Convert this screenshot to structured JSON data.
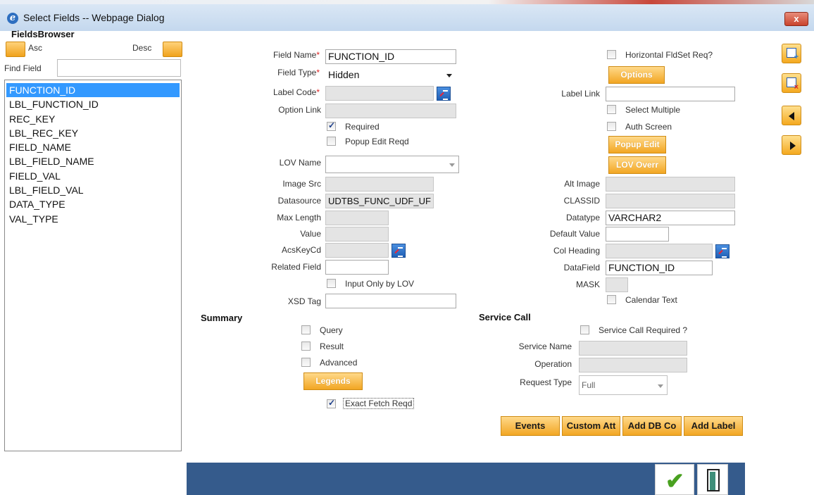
{
  "window": {
    "title": "Select Fields -- Webpage Dialog",
    "close_label": "x"
  },
  "fields_browser": {
    "title": "FieldsBrowser",
    "asc_label": "Asc",
    "desc_label": "Desc",
    "find_label": "Find Field",
    "find_value": "",
    "items": [
      "FUNCTION_ID",
      "LBL_FUNCTION_ID",
      "REC_KEY",
      "LBL_REC_KEY",
      "FIELD_NAME",
      "LBL_FIELD_NAME",
      "FIELD_VAL",
      "LBL_FIELD_VAL",
      "DATA_TYPE",
      "VAL_TYPE"
    ],
    "selected_index": 0
  },
  "form": {
    "field_name": {
      "label": "Field Name",
      "value": "FUNCTION_ID"
    },
    "field_type": {
      "label": "Field Type",
      "value": "Hidden"
    },
    "label_code": {
      "label": "Label Code",
      "value": ""
    },
    "option_link": {
      "label": "Option Link",
      "value": ""
    },
    "required": {
      "label": "Required",
      "checked": true
    },
    "popup_edit_reqd": {
      "label": "Popup Edit Reqd",
      "checked": false
    },
    "lov_name": {
      "label": "LOV Name",
      "value": ""
    },
    "image_src": {
      "label": "Image Src",
      "value": ""
    },
    "datasource": {
      "label": "Datasource",
      "value": "UDTBS_FUNC_UDF_UF"
    },
    "max_length": {
      "label": "Max Length",
      "value": ""
    },
    "value": {
      "label": "Value",
      "value": ""
    },
    "acs_key_cd": {
      "label": "AcsKeyCd",
      "value": ""
    },
    "related_field": {
      "label": "Related Field",
      "value": ""
    },
    "input_only_by_lov": {
      "label": "Input Only by LOV",
      "checked": false
    },
    "xsd_tag": {
      "label": "XSD Tag",
      "value": ""
    },
    "horizontal_fldset": {
      "label": "Horizontal FldSet Req?",
      "checked": false
    },
    "options_button": "Options",
    "label_link": {
      "label": "Label Link",
      "value": ""
    },
    "select_multiple": {
      "label": "Select Multiple",
      "checked": false
    },
    "auth_screen": {
      "label": "Auth Screen",
      "checked": false
    },
    "popup_edit_button": "Popup Edit",
    "lov_overr_button": "LOV Overr",
    "alt_image": {
      "label": "Alt Image",
      "value": ""
    },
    "classid": {
      "label": "CLASSID",
      "value": ""
    },
    "datatype": {
      "label": "Datatype",
      "value": "VARCHAR2"
    },
    "default_value": {
      "label": "Default Value",
      "value": ""
    },
    "col_heading": {
      "label": "Col Heading",
      "value": ""
    },
    "data_field": {
      "label": "DataField",
      "value": "FUNCTION_ID"
    },
    "mask": {
      "label": "MASK",
      "value": ""
    },
    "calendar_text": {
      "label": "Calendar Text",
      "checked": false
    }
  },
  "summary": {
    "title": "Summary",
    "query": {
      "label": "Query",
      "checked": false
    },
    "result": {
      "label": "Result",
      "checked": false
    },
    "advanced": {
      "label": "Advanced",
      "checked": false
    },
    "legends_button": "Legends",
    "exact_fetch": {
      "label": "Exact Fetch Reqd",
      "checked": true
    }
  },
  "service_call": {
    "title": "Service Call",
    "required": {
      "label": "Service Call Required ?",
      "checked": false
    },
    "service_name": {
      "label": "Service Name",
      "value": ""
    },
    "operation": {
      "label": "Operation",
      "value": ""
    },
    "request_type": {
      "label": "Request Type",
      "value": "Full"
    }
  },
  "actions": {
    "events": "Events",
    "custom_att": "Custom Att",
    "add_db_col": "Add DB Co",
    "add_label": "Add Label"
  },
  "colors": {
    "accent_orange": "#f2a623",
    "bottom_bar": "#355b8c",
    "selection": "#3399ff"
  },
  "icons": [
    "add-row-icon",
    "delete-row-icon",
    "arrow-left-icon",
    "arrow-right-icon",
    "ok-check-icon",
    "exit-door-icon"
  ]
}
